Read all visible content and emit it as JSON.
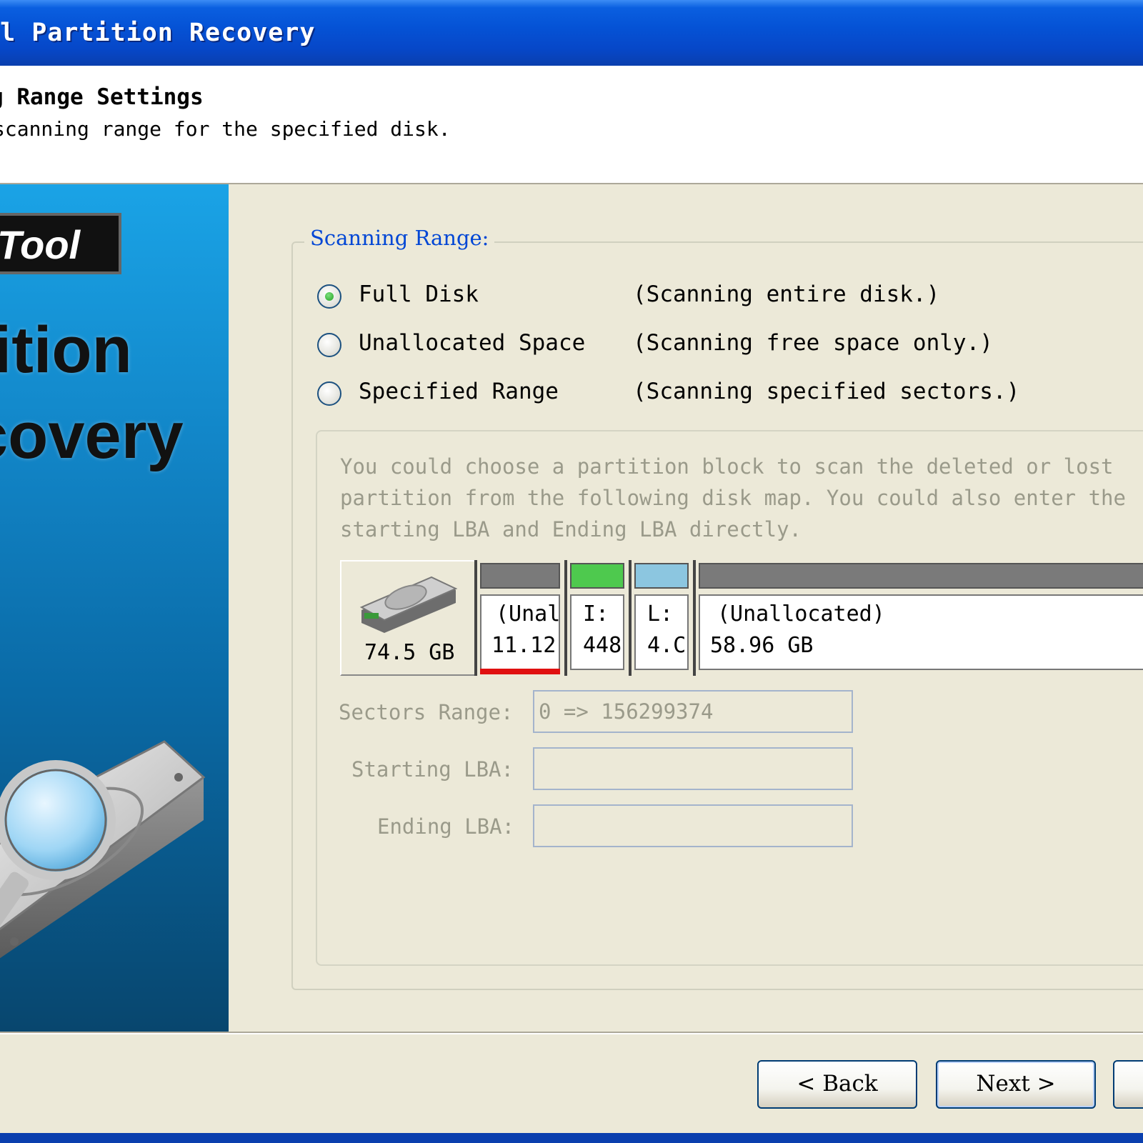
{
  "window": {
    "title": "ol Partition Recovery"
  },
  "header": {
    "title": "g Range Settings",
    "subtitle": "scanning range for the specified disk."
  },
  "banner": {
    "logo": "Tool",
    "word1": "tition",
    "word2": "covery"
  },
  "scan_range": {
    "group_label": "Scanning Range:",
    "options": [
      {
        "label": "Full Disk",
        "desc": "(Scanning entire disk.)",
        "selected": true
      },
      {
        "label": "Unallocated Space",
        "desc": "(Scanning free space only.)",
        "selected": false
      },
      {
        "label": "Specified Range",
        "desc": "(Scanning specified sectors.)",
        "selected": false
      }
    ],
    "hint_lines": [
      "You could choose a partition block to scan the deleted or lost",
      "partition from the following disk map. You could also enter the",
      "starting LBA and Ending LBA directly."
    ]
  },
  "disk_map": {
    "disk_size": "74.5 GB",
    "partitions": [
      {
        "line1": "(Unal",
        "line2": "11.12",
        "bar_color": "#7a7a7a"
      },
      {
        "line1": "I: (",
        "line2": "448",
        "bar_color": "#4ec94e"
      },
      {
        "line1": "L: (",
        "line2": "4.C",
        "bar_color": "#8cc6e0"
      },
      {
        "line1": "(Unallocated)",
        "line2": "58.96 GB",
        "bar_color": "#7a7a7a"
      }
    ]
  },
  "fields": {
    "sectors_range_label": "Sectors Range:",
    "sectors_range_value": "0 => 156299374",
    "starting_lba_label": "Starting LBA:",
    "starting_lba_value": "",
    "ending_lba_label": "Ending LBA:",
    "ending_lba_value": ""
  },
  "buttons": {
    "back": "< Back",
    "next": "Next >"
  }
}
